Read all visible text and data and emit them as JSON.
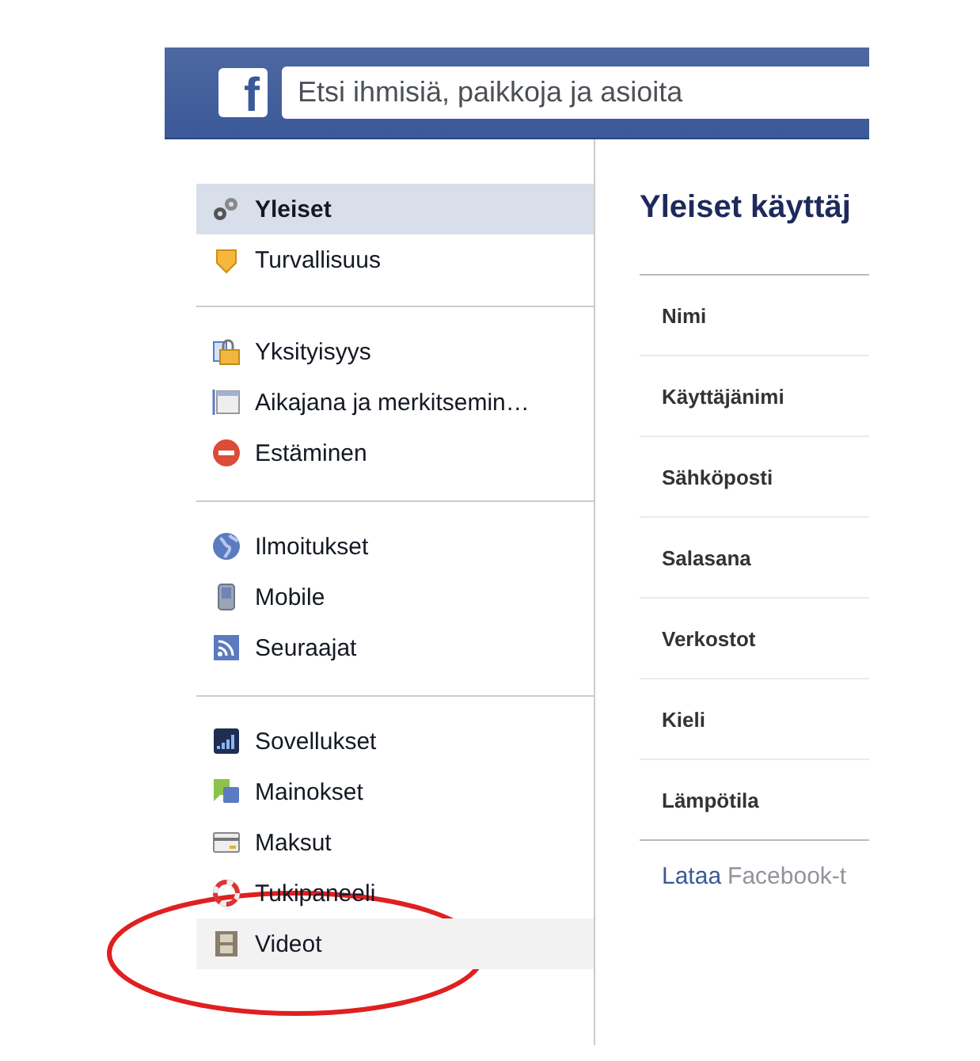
{
  "header": {
    "logo": "f",
    "search": {
      "placeholder": "Etsi ihmisiä, paikkoja ja asioita"
    }
  },
  "sidebar": {
    "groups": [
      {
        "items": [
          {
            "label": "Yleiset",
            "selected": true,
            "hovered": false
          },
          {
            "label": "Turvallisuus",
            "selected": false,
            "hovered": false
          }
        ]
      },
      {
        "items": [
          {
            "label": "Yksityisyys",
            "selected": false,
            "hovered": false
          },
          {
            "label": "Aikajana ja merkitsemin…",
            "selected": false,
            "hovered": false
          },
          {
            "label": "Estäminen",
            "selected": false,
            "hovered": false
          }
        ]
      },
      {
        "items": [
          {
            "label": "Ilmoitukset",
            "selected": false,
            "hovered": false
          },
          {
            "label": "Mobile",
            "selected": false,
            "hovered": false
          },
          {
            "label": "Seuraajat",
            "selected": false,
            "hovered": false
          }
        ]
      },
      {
        "items": [
          {
            "label": "Sovellukset",
            "selected": false,
            "hovered": false
          },
          {
            "label": "Mainokset",
            "selected": false,
            "hovered": false
          },
          {
            "label": "Maksut",
            "selected": false,
            "hovered": false
          },
          {
            "label": "Tukipaneeli",
            "selected": false,
            "hovered": false
          },
          {
            "label": "Videot",
            "selected": false,
            "hovered": true
          }
        ]
      }
    ]
  },
  "content": {
    "title": "Yleiset käyttäj",
    "rows": [
      "Nimi",
      "Käyttäjänimi",
      "Sähköposti",
      "Salasana",
      "Verkostot",
      "Kieli",
      "Lämpötila"
    ],
    "footer": {
      "link": "Lataa",
      "text": "Facebook-t"
    }
  },
  "annotation": {
    "kind": "ellipse",
    "color": "#e02020"
  }
}
